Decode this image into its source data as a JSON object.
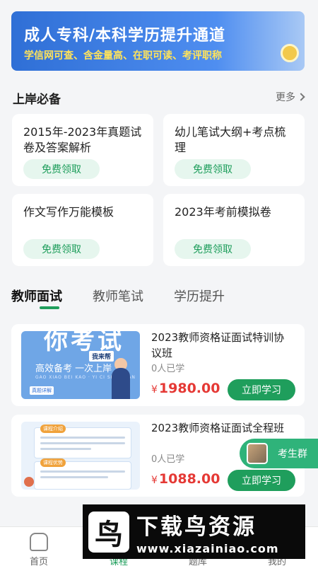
{
  "banner": {
    "title": "成人专科/本科学历提升通道",
    "subtitle": "学信网可查、含金量高、在职可读、考评职称"
  },
  "section": {
    "title": "上岸必备",
    "more": "更多"
  },
  "cards": [
    {
      "title": "2015年-2023年真题试卷及答案解析",
      "button": "免费领取"
    },
    {
      "title": "幼儿笔试大纲+考点梳理",
      "button": "免费领取"
    },
    {
      "title": "作文写作万能模板",
      "button": "免费领取"
    },
    {
      "title": "2023年考前模拟卷",
      "button": "免费领取"
    }
  ],
  "tabs": [
    "教师面试",
    "教师笔试",
    "学历提升"
  ],
  "active_tab": "教师面试",
  "courses": [
    {
      "name": "2023教师资格证面试特训协议班",
      "learners": "0人已学",
      "currency": "¥",
      "price": "1980.00",
      "button": "立即学习",
      "thumb": {
        "big": "你考试",
        "chip": "我来帮",
        "slogan": "高效备考 一次上岸",
        "pinyin": "GAO XIAO BEI KAO · YI CI SHANG AN",
        "tag": "真题详解"
      }
    },
    {
      "name": "2023教师资格证面试全程班",
      "learners": "0人已学",
      "currency": "¥",
      "price": "1088.00",
      "button": "立即学习",
      "thumb": {
        "tag1": "课程介绍",
        "tag2": "课程优势"
      }
    }
  ],
  "float_button": {
    "label": "考生群"
  },
  "tabbar": [
    {
      "label": "首页",
      "icon": "home-icon"
    },
    {
      "label": "课程",
      "icon": "course-icon"
    },
    {
      "label": "题库",
      "icon": "question-bank-icon"
    },
    {
      "label": "我的",
      "icon": "profile-icon"
    }
  ],
  "watermark": {
    "logo": "鸟",
    "text": "下载鸟资源",
    "url": "www.xiazainiao.com"
  },
  "colors": {
    "primary": "#1f9e5c",
    "price": "#e53935",
    "banner": "#2f6fd6"
  }
}
